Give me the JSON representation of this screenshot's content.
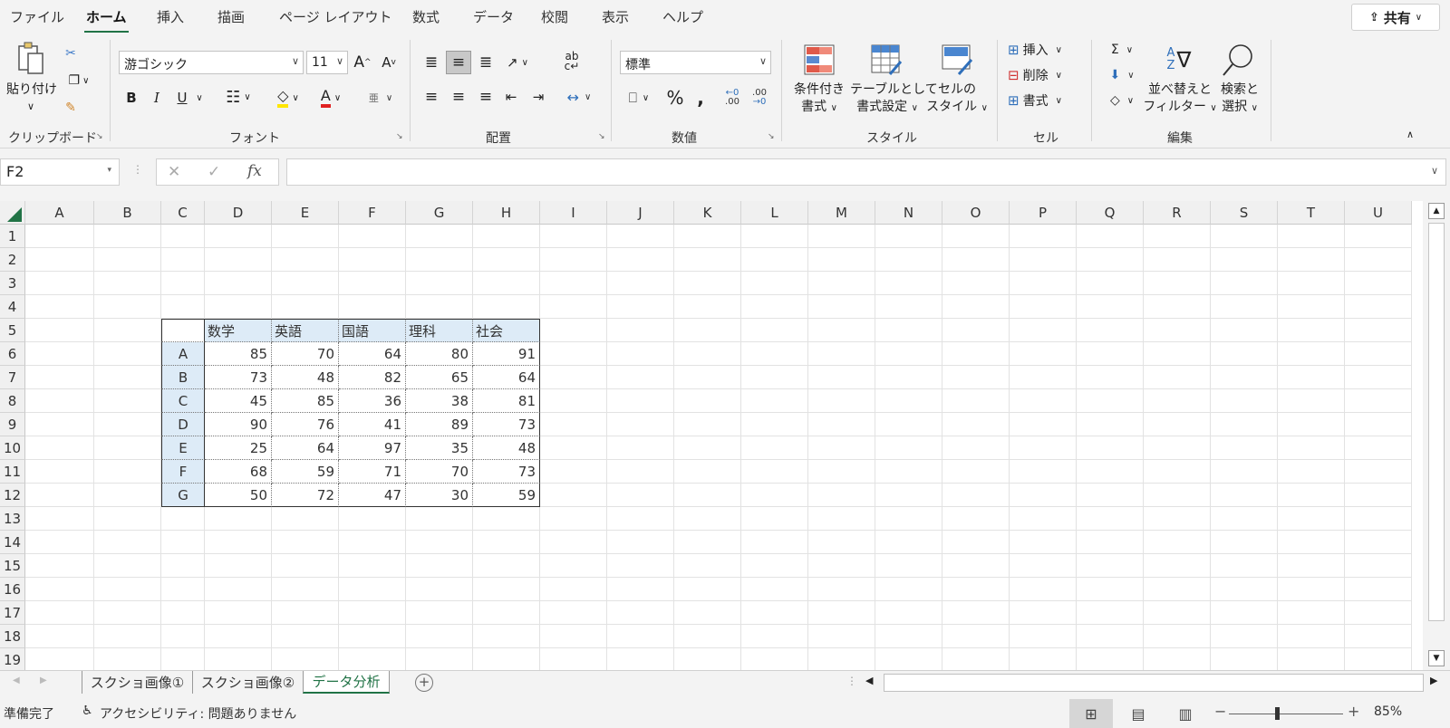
{
  "menu_tabs": [
    "ファイル",
    "ホーム",
    "挿入",
    "描画",
    "ページ レイアウト",
    "数式",
    "データ",
    "校閲",
    "表示",
    "ヘルプ"
  ],
  "active_tab": "ホーム",
  "share_label": "共有",
  "ribbon": {
    "clipboard": {
      "paste_label": "貼り付け",
      "group_label": "クリップボード"
    },
    "font": {
      "font_name": "游ゴシック",
      "font_size": "11",
      "group_label": "フォント",
      "bold": "B",
      "italic": "I",
      "underline": "U"
    },
    "alignment": {
      "group_label": "配置"
    },
    "number": {
      "format": "標準",
      "group_label": "数値"
    },
    "styles": {
      "conditional_l1": "条件付き",
      "conditional_l2": "書式",
      "table_l1": "テーブルとして",
      "table_l2": "書式設定",
      "cell_l1": "セルの",
      "cell_l2": "スタイル",
      "group_label": "スタイル"
    },
    "cells": {
      "insert": "挿入",
      "delete": "削除",
      "format": "書式",
      "group_label": "セル"
    },
    "editing": {
      "sort_l1": "並べ替えと",
      "sort_l2": "フィルター",
      "find_l1": "検索と",
      "find_l2": "選択",
      "group_label": "編集"
    }
  },
  "name_box": "F2",
  "formula_value": "",
  "columns": [
    "A",
    "B",
    "C",
    "D",
    "E",
    "F",
    "G",
    "H",
    "I",
    "J",
    "K",
    "L",
    "M",
    "N",
    "O",
    "P",
    "Q",
    "R",
    "S",
    "T",
    "U"
  ],
  "rows": [
    "1",
    "2",
    "3",
    "4",
    "5",
    "6",
    "7",
    "8",
    "9",
    "10",
    "11",
    "12",
    "13",
    "14",
    "15",
    "16",
    "17",
    "18",
    "19"
  ],
  "table": {
    "headers": [
      "数学",
      "英語",
      "国語",
      "理科",
      "社会"
    ],
    "row_labels": [
      "A",
      "B",
      "C",
      "D",
      "E",
      "F",
      "G"
    ],
    "values": [
      [
        85,
        70,
        64,
        80,
        91
      ],
      [
        73,
        48,
        82,
        65,
        64
      ],
      [
        45,
        85,
        36,
        38,
        81
      ],
      [
        90,
        76,
        41,
        89,
        73
      ],
      [
        25,
        64,
        97,
        35,
        48
      ],
      [
        68,
        59,
        71,
        70,
        73
      ],
      [
        50,
        72,
        47,
        30,
        59
      ]
    ]
  },
  "sheets": [
    "スクショ画像①",
    "スクショ画像②",
    "データ分析"
  ],
  "active_sheet": "データ分析",
  "status": {
    "ready": "準備完了",
    "accessibility": "アクセシビリティ: 問題ありません",
    "zoom": "85%"
  },
  "colors": {
    "accent": "#217346",
    "table_fill": "#ddebf7"
  }
}
